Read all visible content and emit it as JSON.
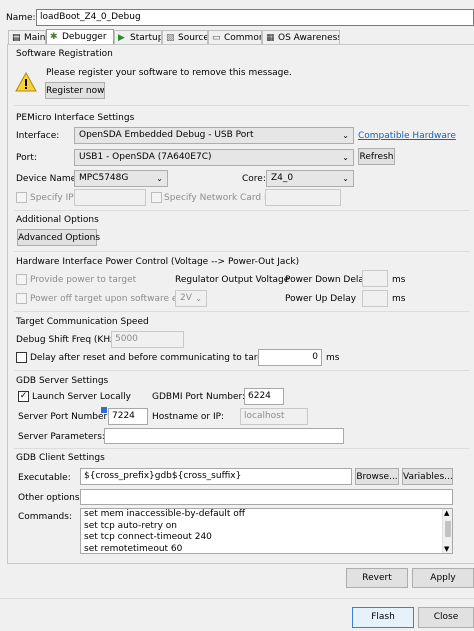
{
  "name_label": "Name:",
  "name_value": "loadBoot_Z4_0_Debug",
  "tabs": [
    {
      "label": "Main",
      "icon": "main-tab-icon"
    },
    {
      "label": "Debugger",
      "icon": "debugger-tab-icon"
    },
    {
      "label": "Startup",
      "icon": "startup-tab-icon"
    },
    {
      "label": "Source",
      "icon": "source-tab-icon"
    },
    {
      "label": "Common",
      "icon": "common-tab-icon"
    },
    {
      "label": "OS Awareness",
      "icon": "os-awareness-tab-icon"
    }
  ],
  "software_registration": {
    "title": "Software Registration",
    "message": "Please register your software to remove this message.",
    "register_button": "Register now",
    "icon": "warning-icon"
  },
  "pemicro": {
    "title": "PEMicro Interface Settings",
    "interface_label": "Interface:",
    "interface_value": "OpenSDA Embedded Debug - USB Port",
    "compatible_link": "Compatible Hardware",
    "port_label": "Port:",
    "port_value": "USB1 - OpenSDA (7A640E7C)",
    "refresh_button": "Refresh",
    "device_label": "Device Name:",
    "device_value": "MPC5748G",
    "core_label": "Core:",
    "core_value": "Z4_0",
    "specify_ip_label": "Specify IP",
    "specify_nic_label": "Specify Network Card IP"
  },
  "additional": {
    "title": "Additional Options",
    "button": "Advanced Options"
  },
  "power": {
    "title": "Hardware Interface Power Control (Voltage --> Power-Out Jack)",
    "provide_power_label": "Provide power to target",
    "regulator_label": "Regulator Output Voltage",
    "power_down_label": "Power Down Delay",
    "power_down_unit": "ms",
    "power_off_label": "Power off target upon software exit",
    "voltage_value": "2V",
    "power_up_label": "Power Up Delay",
    "power_up_unit": "ms"
  },
  "comm": {
    "title": "Target Communication Speed",
    "shift_label": "Debug Shift Freq (KHz)",
    "shift_value": "5000",
    "delay_label": "Delay after reset and before communicating to target for",
    "delay_value": "0",
    "delay_unit": "ms"
  },
  "gdb_server": {
    "title": "GDB Server Settings",
    "launch_label": "Launch Server Locally",
    "launch_checked": true,
    "gdbmi_label": "GDBMI Port Number:",
    "gdbmi_value": "6224",
    "server_port_label": "Server Port Number:",
    "server_port_value": "7224",
    "hostname_label": "Hostname or IP:",
    "hostname_value": "localhost",
    "params_label": "Server Parameters:",
    "params_value": ""
  },
  "gdb_client": {
    "title": "GDB Client Settings",
    "exec_label": "Executable:",
    "exec_value": "${cross_prefix}gdb${cross_suffix}",
    "browse_button": "Browse...",
    "variables_button": "Variables...",
    "other_label": "Other options:",
    "other_value": "",
    "commands_label": "Commands:",
    "commands": [
      "set mem inaccessible-by-default off",
      "set tcp auto-retry on",
      "set tcp connect-timeout 240",
      "set remotetimeout 60"
    ]
  },
  "footer": {
    "revert": "Revert",
    "apply": "Apply",
    "flash": "Flash",
    "close": "Close"
  }
}
